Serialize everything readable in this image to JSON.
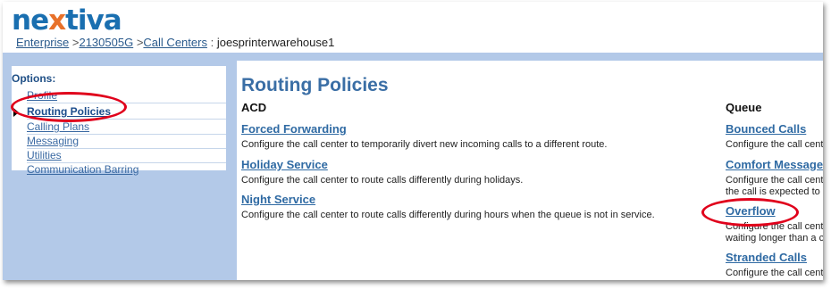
{
  "brand": {
    "logo_pre": "ne",
    "logo_x": "x",
    "logo_post": "tiva"
  },
  "breadcrumb": {
    "enterprise": "Enterprise",
    "sep1": ">",
    "group_id": "2130505G",
    "sep2": ">",
    "call_centers": "Call Centers",
    "sep3": ":",
    "current": "joesprinterwarehouse1"
  },
  "sidebar": {
    "title": "Options:",
    "items": [
      {
        "label": "Profile"
      },
      {
        "label": "Routing Policies"
      },
      {
        "label": "Calling Plans"
      },
      {
        "label": "Messaging"
      },
      {
        "label": "Utilities"
      },
      {
        "label": "Communication Barring"
      }
    ]
  },
  "main": {
    "title": "Routing Policies",
    "acd": {
      "heading": "ACD",
      "items": [
        {
          "label": "Forced Forwarding",
          "desc": "Configure the call center to temporarily divert new incoming calls to a different route."
        },
        {
          "label": "Holiday Service",
          "desc": "Configure the call center to route calls differently during holidays."
        },
        {
          "label": "Night Service",
          "desc": "Configure the call center to route calls differently during hours when the queue is not in service."
        }
      ]
    },
    "queue": {
      "heading": "Queue",
      "items": [
        {
          "label": "Bounced Calls",
          "desc": "Configure the call cente"
        },
        {
          "label": "Comfort Message",
          "desc": "Configure the call cente",
          "desc2": "the call is expected to b"
        },
        {
          "label": "Overflow",
          "desc": "Configure the call cente",
          "desc2": "waiting longer than a c"
        },
        {
          "label": "Stranded Calls",
          "desc": "Configure the call cente"
        }
      ]
    }
  },
  "colors": {
    "accent": "#3a6ea5",
    "sidebar_bg": "#b3c9e8",
    "highlight_ring": "#e0001b",
    "logo_orange": "#e8712a"
  }
}
